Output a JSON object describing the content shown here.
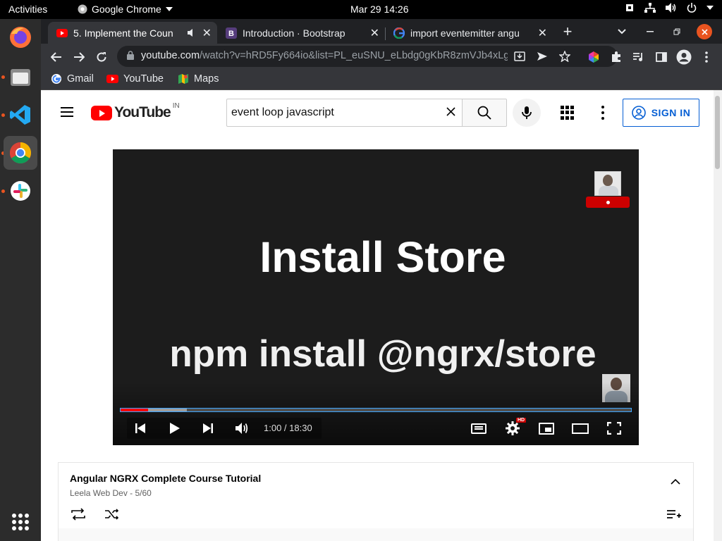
{
  "system": {
    "activities": "Activities",
    "app_name": "Google Chrome",
    "clock": "Mar 29  14:26"
  },
  "dock": {
    "items": [
      "firefox-icon",
      "files-icon",
      "vscode-icon",
      "chrome-icon",
      "slack-icon"
    ]
  },
  "browser": {
    "tabs": [
      {
        "title": "5. Implement the Coun",
        "favicon": "youtube-icon",
        "active": true,
        "muted_audio": true
      },
      {
        "title": "Introduction · Bootstrap",
        "favicon": "bootstrap-icon",
        "active": false
      },
      {
        "title": "import eventemitter angu",
        "favicon": "google-icon",
        "active": false
      }
    ],
    "url_domain": "youtube.com",
    "url_path": "/watch?v=hRD5Fy664io&list=PL_euSNU_eLbdg0gKbR8zmVJb4xLg...",
    "bookmarks": [
      "Gmail",
      "YouTube",
      "Maps"
    ]
  },
  "youtube": {
    "logo_text": "YouTube",
    "country_code": "IN",
    "search_value": "event loop javascript",
    "signin_label": "SIGN IN",
    "video": {
      "slide_title": "Install Store",
      "slide_subtitle": "npm install @ngrx/store",
      "time_display": "1:00 / 18:30",
      "played_fraction": 0.054,
      "loaded_fraction": 0.13,
      "hd_badge": "HD"
    },
    "playlist": {
      "title": "Angular NGRX Complete Course Tutorial",
      "meta": "Leela Web Dev - 5/60"
    }
  },
  "colors": {
    "youtube_red": "#ff0000",
    "signin_blue": "#065fd4",
    "ubuntu_orange": "#e95420"
  }
}
